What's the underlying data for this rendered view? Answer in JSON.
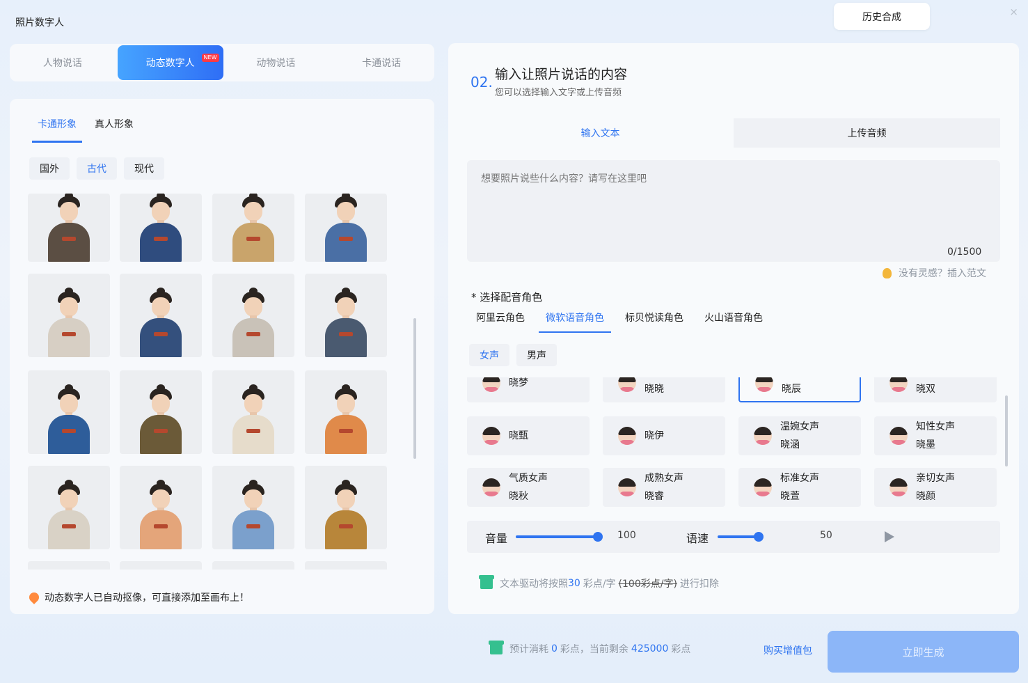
{
  "window": {
    "title": "照片数字人",
    "close": "×",
    "history_button": "历史合成"
  },
  "main_tabs": [
    {
      "label": "人物说话"
    },
    {
      "label": "动态数字人",
      "badge": "NEW"
    },
    {
      "label": "动物说话"
    },
    {
      "label": "卡通说话"
    }
  ],
  "left": {
    "sub_tabs": [
      "卡通形象",
      "真人形象"
    ],
    "eras": [
      "国外",
      "古代",
      "现代"
    ],
    "figures": [
      {
        "robe": "#5b4e43"
      },
      {
        "robe": "#2f4c7e"
      },
      {
        "robe": "#c9a46b"
      },
      {
        "robe": "#4a6fa5"
      },
      {
        "robe": "#d7cfc4"
      },
      {
        "robe": "#34507d"
      },
      {
        "robe": "#c9c2b8"
      },
      {
        "robe": "#4a5a70"
      },
      {
        "robe": "#2e5d9a"
      },
      {
        "robe": "#6b5a38"
      },
      {
        "robe": "#e6dccb"
      },
      {
        "robe": "#e08a4a"
      },
      {
        "robe": "#d9d2c6"
      },
      {
        "robe": "#e4a57a"
      },
      {
        "robe": "#7ba0cc"
      },
      {
        "robe": "#b8863a"
      }
    ],
    "tip": "动态数字人已自动抠像，可直接添加至画布上！"
  },
  "right": {
    "step_number": "02.",
    "step_title": "输入让照片说话的内容",
    "step_subtitle": "您可以选择输入文字或上传音频",
    "input_tabs": [
      "输入文本",
      "上传音频"
    ],
    "textarea_placeholder": "想要照片说些什么内容？请写在这里吧",
    "char_count": "0/1500",
    "inspire": "没有灵感？插入范文",
    "voice_label": "* 选择配音角色",
    "vendors": [
      "阿里云角色",
      "微软语音角色",
      "标贝悦读角色",
      "火山语音角色"
    ],
    "genders": [
      "女声",
      "男声"
    ],
    "voices_top": [
      "晓梦",
      "晓晓",
      "晓辰",
      "晓双"
    ],
    "voices": [
      {
        "type": "",
        "name": "晓甄"
      },
      {
        "type": "",
        "name": "晓伊"
      },
      {
        "type": "温婉女声",
        "name": "晓涵"
      },
      {
        "type": "知性女声",
        "name": "晓墨"
      },
      {
        "type": "气质女声",
        "name": "晓秋"
      },
      {
        "type": "成熟女声",
        "name": "晓睿"
      },
      {
        "type": "标准女声",
        "name": "晓萱"
      },
      {
        "type": "亲切女声",
        "name": "晓颜"
      }
    ],
    "volume_label": "音量",
    "volume_value": "100",
    "volume_level": 1.0,
    "speed_label": "语速",
    "speed_value": "50",
    "speed_level": 0.5,
    "rule_prefix": "文本驱动将按照",
    "rule_price": "30",
    "rule_unit": "彩点/字",
    "rule_old": "(100彩点/字)",
    "rule_suffix": "进行扣除"
  },
  "footer": {
    "estimate_prefix": "预计消耗",
    "estimate_cost": "0",
    "estimate_mid": "彩点，当前剩余",
    "estimate_balance": "425000",
    "estimate_suffix": "彩点",
    "buy_link": "购买增值包",
    "generate_button": "立即生成"
  },
  "colors": {
    "accent": "#2f74f0",
    "generate_disabled": "#8cb6f8",
    "gift": "#35c08f"
  }
}
